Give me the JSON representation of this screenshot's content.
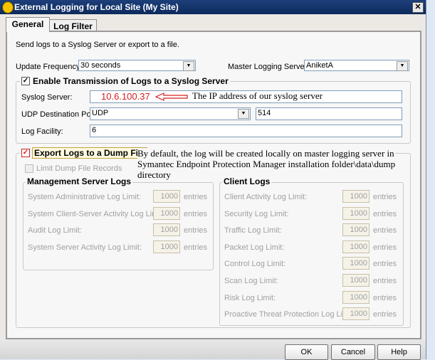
{
  "window": {
    "title": "External Logging for Local Site (My Site)",
    "close_icon": "close-icon",
    "app_icon": "symantec-shield-icon"
  },
  "tabs": [
    {
      "label": "General",
      "active": true
    },
    {
      "label": "Log Filter",
      "active": false
    }
  ],
  "general": {
    "intro": "Send logs to a Syslog Server or export to a file.",
    "update_frequency": {
      "label": "Update Frequency:",
      "value": "30 seconds"
    },
    "master_logging_server": {
      "label": "Master Logging Server:",
      "value": "AniketA"
    },
    "syslog": {
      "header": "Enable Transmission of Logs to a Syslog Server",
      "checked": true,
      "server_label": "Syslog Server:",
      "server_value": "10.6.100.37",
      "port_label": "UDP Destination Port:",
      "protocol": "UDP",
      "port": "514",
      "facility_label": "Log Facility:",
      "facility": "6"
    },
    "export": {
      "header": "Export Logs to a Dump File",
      "checked": true,
      "limit_label": "Limit Dump File Records",
      "limit_checked": false,
      "management": {
        "header": "Management Server Logs",
        "rows": [
          {
            "label": "System Administrative Log Limit:",
            "value": "1000",
            "unit": "entries"
          },
          {
            "label": "System Client-Server Activity Log Limit:",
            "value": "1000",
            "unit": "entries"
          },
          {
            "label": "Audit Log Limit:",
            "value": "1000",
            "unit": "entries"
          },
          {
            "label": "System Server Activity Log Limit:",
            "value": "1000",
            "unit": "entries"
          }
        ]
      },
      "client": {
        "header": "Client Logs",
        "rows": [
          {
            "label": "Client Activity Log Limit:",
            "value": "1000",
            "unit": "entries"
          },
          {
            "label": "Security Log Limit:",
            "value": "1000",
            "unit": "entries"
          },
          {
            "label": "Traffic Log Limit:",
            "value": "1000",
            "unit": "entries"
          },
          {
            "label": "Packet Log Limit:",
            "value": "1000",
            "unit": "entries"
          },
          {
            "label": "Control Log Limit:",
            "value": "1000",
            "unit": "entries"
          },
          {
            "label": "Scan Log Limit:",
            "value": "1000",
            "unit": "entries"
          },
          {
            "label": "Risk Log Limit:",
            "value": "1000",
            "unit": "entries"
          },
          {
            "label": "Proactive Threat Protection Log Limit:",
            "value": "1000",
            "unit": "entries"
          }
        ]
      }
    }
  },
  "annotations": {
    "syslog_note": "The IP address of our syslog server",
    "dump_note": [
      "By default, the log will be created locally on master logging server in",
      "Symantec Endpoint Protection Manager installation folder\\data\\dump",
      "directory"
    ],
    "color": "#d42020"
  },
  "buttons": {
    "ok": "OK",
    "cancel": "Cancel",
    "help": "Help"
  }
}
